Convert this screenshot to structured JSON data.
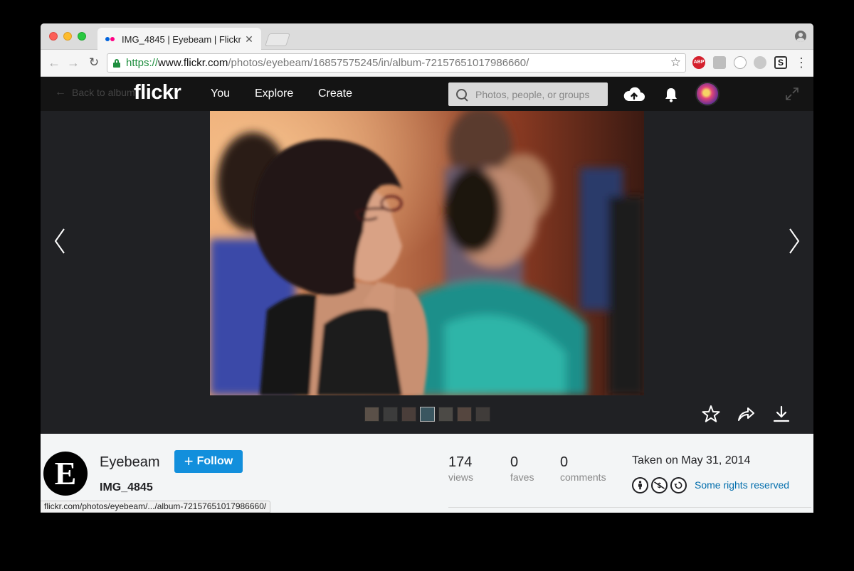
{
  "browser": {
    "tab_title": "IMG_4845 | Eyebeam | Flickr",
    "tab_close": "✕",
    "url_scheme": "https://",
    "url_host": "www.flickr.com",
    "url_path": "/photos/eyebeam/16857575245/in/album-72157651017986660/",
    "ext_abp": "ABP",
    "ext_s": "S",
    "status_url": "flickr.com/photos/eyebeam/.../album-72157651017986660/"
  },
  "nav": {
    "back_label": "Back to album",
    "logo": "flickr",
    "you": "You",
    "explore": "Explore",
    "create": "Create",
    "search_placeholder": "Photos, people, or groups"
  },
  "photo": {
    "thumbnail_count": 7,
    "current_thumbnail": 4
  },
  "info": {
    "owner_initial": "E",
    "owner_name": "Eyebeam",
    "follow_label": "Follow",
    "follow_plus": "+",
    "title": "IMG_4845",
    "stats": [
      {
        "value": "174",
        "label": "views"
      },
      {
        "value": "0",
        "label": "faves"
      },
      {
        "value": "0",
        "label": "comments"
      }
    ],
    "taken": "Taken on May 31, 2014",
    "rights": "Some rights reserved"
  },
  "colors": {
    "flickr_blue": "#0063dc",
    "flickr_pink": "#ff0084",
    "follow_blue": "#128fdc",
    "link_blue": "#006dac"
  }
}
